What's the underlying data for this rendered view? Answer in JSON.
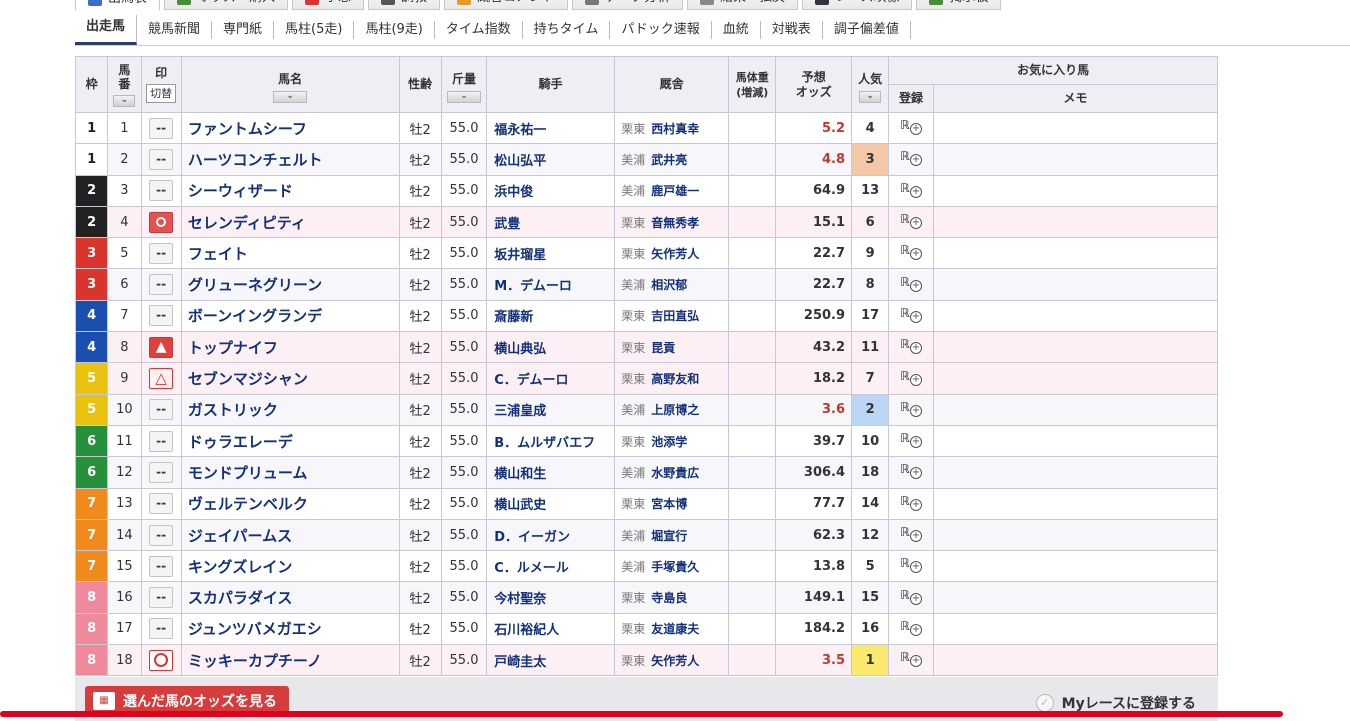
{
  "main_tabs": [
    {
      "label": "出馬表",
      "color": "#3a6fc4",
      "active": true
    },
    {
      "label": "オッズ・購入",
      "color": "#4a8a3a"
    },
    {
      "label": "予想",
      "color": "#d33"
    },
    {
      "label": "調教",
      "color": "#555"
    },
    {
      "label": "厩舎コメント",
      "color": "#e89a2a"
    },
    {
      "label": "データ分析",
      "color": "#777"
    },
    {
      "label": "結果・払戻",
      "color": "#888"
    },
    {
      "label": "レース映像",
      "color": "#334"
    },
    {
      "label": "掲示板",
      "color": "#4a8a3a"
    }
  ],
  "sub_tabs": [
    "出走馬",
    "競馬新聞",
    "専門紙",
    "馬柱(5走)",
    "馬柱(9走)",
    "タイム指数",
    "持ちタイム",
    "パドック速報",
    "血統",
    "対戦表",
    "調子偏差値"
  ],
  "headers": {
    "waku": "枠",
    "umaban": "馬番",
    "mark": "印",
    "kirikae": "切替",
    "name": "馬名",
    "sex_age": "性齢",
    "kinryo": "斤量",
    "jockey": "騎手",
    "trainer": "厩舎",
    "weight": "馬体重",
    "weight_sub": "(増減)",
    "odds": "予想",
    "odds_sub": "オッズ",
    "popularity": "人気",
    "favorite": "お気に入り馬",
    "register": "登録",
    "memo": "メモ",
    "sort_glyph": "⌄"
  },
  "waku_colors": {
    "1": {
      "bg": "#ffffff",
      "fg": "#222222"
    },
    "2": {
      "bg": "#222222",
      "fg": "#ffffff"
    },
    "3": {
      "bg": "#d9352c",
      "fg": "#ffffff"
    },
    "4": {
      "bg": "#1a4fb0",
      "fg": "#ffffff"
    },
    "5": {
      "bg": "#e8c20f",
      "fg": "#ffffff"
    },
    "6": {
      "bg": "#27903b",
      "fg": "#ffffff"
    },
    "7": {
      "bg": "#f08a1d",
      "fg": "#ffffff"
    },
    "8": {
      "bg": "#ef8a9c",
      "fg": "#ffffff"
    }
  },
  "horses": [
    {
      "waku": "1",
      "umaban": "1",
      "mark": "--",
      "name": "ファントムシーフ",
      "sex_age": "牡2",
      "kinryo": "55.0",
      "jockey": "福永祐一",
      "area": "栗東",
      "trainer": "西村真幸",
      "odds": "5.2",
      "popularity": "4"
    },
    {
      "waku": "1",
      "umaban": "2",
      "mark": "--",
      "name": "ハーツコンチェルト",
      "sex_age": "牡2",
      "kinryo": "55.0",
      "jockey": "松山弘平",
      "area": "美浦",
      "trainer": "武井亮",
      "odds": "4.8",
      "popularity": "3"
    },
    {
      "waku": "2",
      "umaban": "3",
      "mark": "--",
      "name": "シーウィザード",
      "sex_age": "牡2",
      "kinryo": "55.0",
      "jockey": "浜中俊",
      "area": "美浦",
      "trainer": "鹿戸雄一",
      "odds": "64.9",
      "popularity": "13"
    },
    {
      "waku": "2",
      "umaban": "4",
      "mark": "◎",
      "name": "セレンディピティ",
      "sex_age": "牡2",
      "kinryo": "55.0",
      "jockey": "武豊",
      "area": "栗東",
      "trainer": "音無秀孝",
      "odds": "15.1",
      "popularity": "6"
    },
    {
      "waku": "3",
      "umaban": "5",
      "mark": "--",
      "name": "フェイト",
      "sex_age": "牡2",
      "kinryo": "55.0",
      "jockey": "坂井瑠星",
      "area": "栗東",
      "trainer": "矢作芳人",
      "odds": "22.7",
      "popularity": "9"
    },
    {
      "waku": "3",
      "umaban": "6",
      "mark": "--",
      "name": "グリューネグリーン",
      "sex_age": "牡2",
      "kinryo": "55.0",
      "jockey": "M．デムーロ",
      "area": "美浦",
      "trainer": "相沢郁",
      "odds": "22.7",
      "popularity": "8"
    },
    {
      "waku": "4",
      "umaban": "7",
      "mark": "--",
      "name": "ボーンイングランデ",
      "sex_age": "牡2",
      "kinryo": "55.0",
      "jockey": "斎藤新",
      "area": "栗東",
      "trainer": "吉田直弘",
      "odds": "250.9",
      "popularity": "17"
    },
    {
      "waku": "4",
      "umaban": "8",
      "mark": "▲",
      "name": "トップナイフ",
      "sex_age": "牡2",
      "kinryo": "55.0",
      "jockey": "横山典弘",
      "area": "栗東",
      "trainer": "昆貢",
      "odds": "43.2",
      "popularity": "11"
    },
    {
      "waku": "5",
      "umaban": "9",
      "mark": "△",
      "name": "セブンマジシャン",
      "sex_age": "牡2",
      "kinryo": "55.0",
      "jockey": "C．デムーロ",
      "area": "栗東",
      "trainer": "高野友和",
      "odds": "18.2",
      "popularity": "7"
    },
    {
      "waku": "5",
      "umaban": "10",
      "mark": "--",
      "name": "ガストリック",
      "sex_age": "牡2",
      "kinryo": "55.0",
      "jockey": "三浦皇成",
      "area": "美浦",
      "trainer": "上原博之",
      "odds": "3.6",
      "popularity": "2"
    },
    {
      "waku": "6",
      "umaban": "11",
      "mark": "--",
      "name": "ドゥラエレーデ",
      "sex_age": "牡2",
      "kinryo": "55.0",
      "jockey": "B．ムルザバエフ",
      "area": "栗東",
      "trainer": "池添学",
      "odds": "39.7",
      "popularity": "10"
    },
    {
      "waku": "6",
      "umaban": "12",
      "mark": "--",
      "name": "モンドプリューム",
      "sex_age": "牡2",
      "kinryo": "55.0",
      "jockey": "横山和生",
      "area": "美浦",
      "trainer": "水野貴広",
      "odds": "306.4",
      "popularity": "18"
    },
    {
      "waku": "7",
      "umaban": "13",
      "mark": "--",
      "name": "ヴェルテンベルク",
      "sex_age": "牡2",
      "kinryo": "55.0",
      "jockey": "横山武史",
      "area": "栗東",
      "trainer": "宮本博",
      "odds": "77.7",
      "popularity": "14"
    },
    {
      "waku": "7",
      "umaban": "14",
      "mark": "--",
      "name": "ジェイパームス",
      "sex_age": "牡2",
      "kinryo": "55.0",
      "jockey": "D．イーガン",
      "area": "美浦",
      "trainer": "堀宣行",
      "odds": "62.3",
      "popularity": "12"
    },
    {
      "waku": "7",
      "umaban": "15",
      "mark": "--",
      "name": "キングズレイン",
      "sex_age": "牡2",
      "kinryo": "55.0",
      "jockey": "C．ルメール",
      "area": "美浦",
      "trainer": "手塚貴久",
      "odds": "13.8",
      "popularity": "5"
    },
    {
      "waku": "8",
      "umaban": "16",
      "mark": "--",
      "name": "スカパラダイス",
      "sex_age": "牡2",
      "kinryo": "55.0",
      "jockey": "今村聖奈",
      "area": "栗東",
      "trainer": "寺島良",
      "odds": "149.1",
      "popularity": "15"
    },
    {
      "waku": "8",
      "umaban": "17",
      "mark": "--",
      "name": "ジュンツバメガエシ",
      "sex_age": "牡2",
      "kinryo": "55.0",
      "jockey": "石川裕紀人",
      "area": "栗東",
      "trainer": "友道康夫",
      "odds": "184.2",
      "popularity": "16"
    },
    {
      "waku": "8",
      "umaban": "18",
      "mark": "○",
      "name": "ミッキーカプチーノ",
      "sex_age": "牡2",
      "kinryo": "55.0",
      "jockey": "戸崎圭太",
      "area": "栗東",
      "trainer": "矢作芳人",
      "odds": "3.5",
      "popularity": "1"
    }
  ],
  "bottom": {
    "odds_button": "選んだ馬のオッズを見る",
    "my_race": "Myレースに登録する"
  },
  "colors": {
    "odds_hot": "#c0392b",
    "pop1": "#fbe96e",
    "pop2": "#bcd6f5",
    "pop3": "#f3c8a8",
    "header_bg": "#eeeef5",
    "link": "#13307a",
    "accent_red": "#e3001b"
  }
}
